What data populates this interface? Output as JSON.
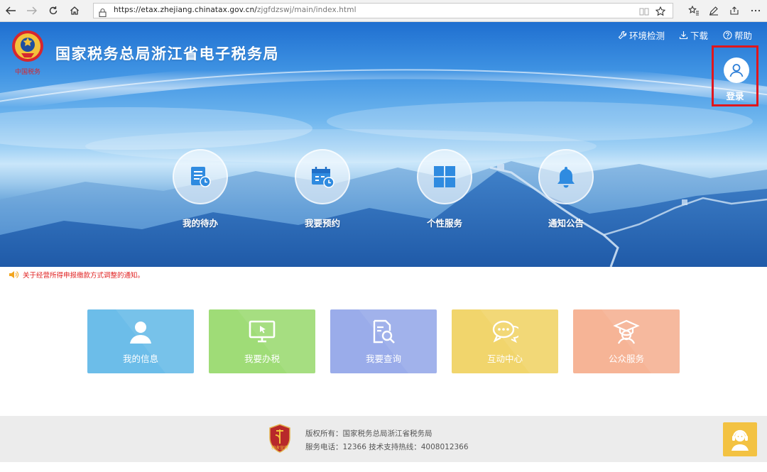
{
  "browser": {
    "url_host": "https://etax.zhejiang.chinatax.gov.cn/",
    "url_path": "zjgfdzswj/main/index.html"
  },
  "header": {
    "emblem_caption": "中国税务",
    "site_title": "国家税务总局浙江省电子税务局",
    "links": [
      {
        "label": "环境检测",
        "icon": "wrench-icon"
      },
      {
        "label": "下载",
        "icon": "download-icon"
      },
      {
        "label": "帮助",
        "icon": "help-icon"
      }
    ],
    "login_label": "登录"
  },
  "quick_access": [
    {
      "label": "我的待办",
      "icon": "todo-document-icon"
    },
    {
      "label": "我要预约",
      "icon": "calendar-clock-icon"
    },
    {
      "label": "个性服务",
      "icon": "grid-icon"
    },
    {
      "label": "通知公告",
      "icon": "bell-icon"
    }
  ],
  "notice": {
    "text": "关于经营所得申报缴款方式调整的通知。"
  },
  "tiles": [
    {
      "label": "我的信息",
      "icon": "user-icon",
      "color": "#6cbde9"
    },
    {
      "label": "我要办税",
      "icon": "monitor-icon",
      "color": "#9fdc77"
    },
    {
      "label": "我要查询",
      "icon": "document-search-icon",
      "color": "#9aacea"
    },
    {
      "label": "互动中心",
      "icon": "chat-bubbles-icon",
      "color": "#f1d56c"
    },
    {
      "label": "公众服务",
      "icon": "graduate-icon",
      "color": "#f6b496"
    }
  ],
  "footer": {
    "logo_caption": "税收宣传",
    "copyright": "版权所有：国家税务总局浙江省税务局",
    "hotline": "服务电话：12366 技术支持热线：4008012366"
  },
  "colors": {
    "accent_red": "#e0161c",
    "notice_red": "#e02020",
    "hero_blue": "#2d7fd8"
  }
}
